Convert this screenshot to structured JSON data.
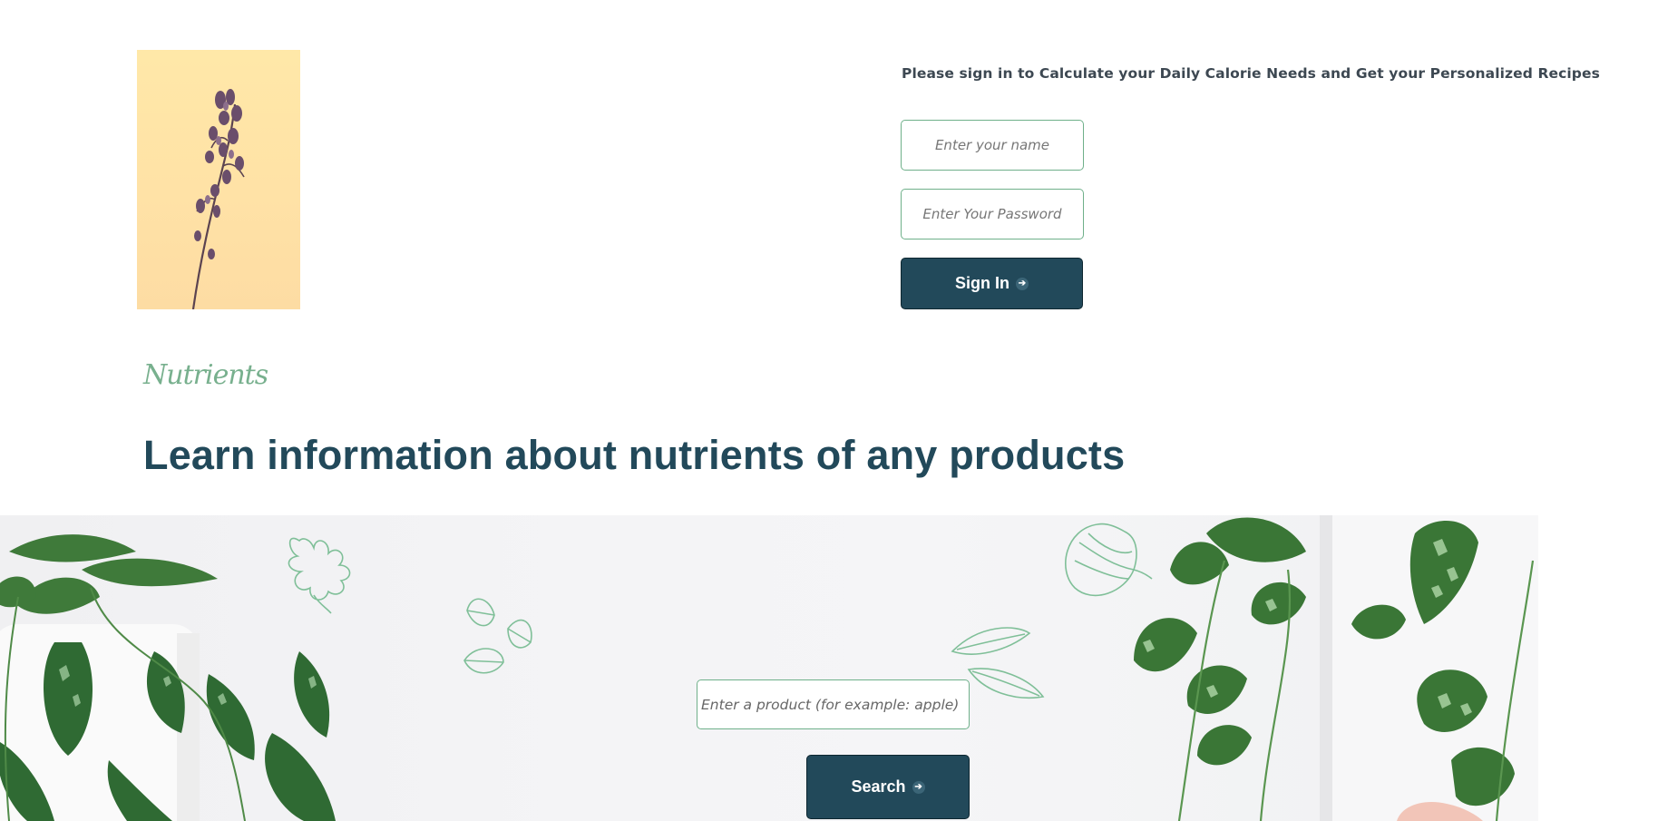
{
  "signin": {
    "heading": "Please sign in to Calculate your Daily Calorie Needs and Get your Personalized Recipes",
    "name_placeholder": "Enter your name",
    "password_placeholder": "Enter Your Password",
    "button_label": "Sign In"
  },
  "nutrients": {
    "script_label": "Nutrients",
    "title": "Learn information about nutrients of any products",
    "search_placeholder": "Enter a product (for example: apple)",
    "search_button_label": "Search"
  },
  "icons": {
    "button_arrow": "arrow-right-icon",
    "hero": "lavender-sprig-icon",
    "decor": [
      "oak-leaf-icon",
      "leaves-icon",
      "onion-icon",
      "leaf-pods-icon",
      "pothos-plant-icon"
    ]
  },
  "colors": {
    "primary": "#22495a",
    "accent_green": "#78b08e",
    "field_border": "#6fb08a",
    "hero_bg": "#ffe2a6",
    "banner_bg": "#f4f4f6"
  }
}
